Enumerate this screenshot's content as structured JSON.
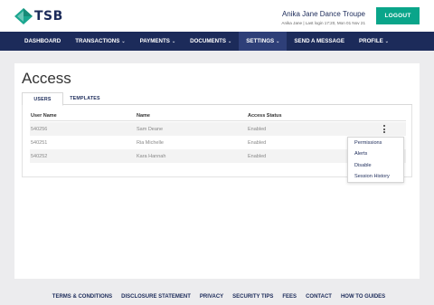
{
  "brand": {
    "name": "TSB",
    "colors": {
      "navy": "#1c2b5a",
      "green": "#0aa58a",
      "logo_teal": "#1aa68f"
    }
  },
  "header": {
    "account_name": "Anika Jane Dance Troupe",
    "last_login": "Anika Jane | Last login 17:20, Mon 01 Nov 21",
    "logout_label": "LOGOUT"
  },
  "nav": {
    "items": [
      {
        "label": "DASHBOARD",
        "chevron": false
      },
      {
        "label": "TRANSACTIONS",
        "chevron": true
      },
      {
        "label": "PAYMENTS",
        "chevron": true
      },
      {
        "label": "DOCUMENTS",
        "chevron": true
      },
      {
        "label": "SETTINGS",
        "chevron": true,
        "active": true
      },
      {
        "label": "SEND A MESSAGE",
        "chevron": false
      },
      {
        "label": "PROFILE",
        "chevron": true
      }
    ],
    "chevron_glyph": "⌄"
  },
  "page": {
    "title": "Access",
    "tabs": [
      {
        "label": "USERS",
        "active": true
      },
      {
        "label": "TEMPLATES",
        "active": false
      }
    ]
  },
  "table": {
    "headers": [
      "User Name",
      "Name",
      "Access Status"
    ],
    "rows": [
      {
        "user_name": "540256",
        "name": "Sam Deane",
        "status": "Enabled"
      },
      {
        "user_name": "540251",
        "name": "Ria Michelle",
        "status": "Enabled"
      },
      {
        "user_name": "540252",
        "name": "Kara Hannah",
        "status": "Enabled"
      }
    ]
  },
  "row_menu": {
    "items": [
      "Permissions",
      "Alerts",
      "Disable",
      "Session History"
    ]
  },
  "footer": {
    "links": [
      "TERMS & CONDITIONS",
      "DISCLOSURE STATEMENT",
      "PRIVACY",
      "SECURITY TIPS",
      "FEES",
      "CONTACT",
      "HOW TO GUIDES"
    ]
  }
}
